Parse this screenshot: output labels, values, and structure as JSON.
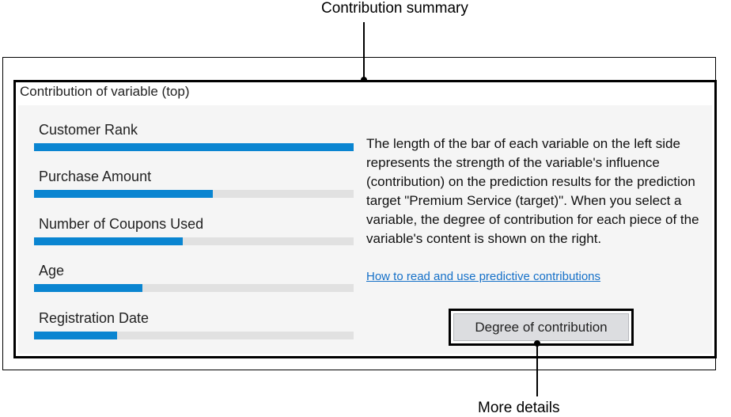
{
  "callouts": {
    "top": "Contribution summary",
    "bottom": "More details"
  },
  "panel": {
    "title": "Contribution of variable (top)",
    "variables": [
      {
        "label": "Customer Rank",
        "contribution": 1.0
      },
      {
        "label": "Purchase Amount",
        "contribution": 0.56
      },
      {
        "label": "Number of Coupons Used",
        "contribution": 0.465
      },
      {
        "label": "Age",
        "contribution": 0.34
      },
      {
        "label": "Registration Date",
        "contribution": 0.26
      }
    ],
    "description": "The length of the bar of each variable on the left side represents the strength of the variable's influence (contribution) on the prediction results for the prediction target \"Premium Service (target)\". When you select a variable, the degree of contribution for each piece of the variable's content is shown on the right.",
    "help_link": "How to read and use predictive contributions",
    "button_label": "Degree of contribution"
  },
  "colors": {
    "bar_fill": "#0a85d1",
    "bar_track": "#e1e1e1",
    "link": "#1570c8",
    "panel_background": "#f5f5f5"
  }
}
